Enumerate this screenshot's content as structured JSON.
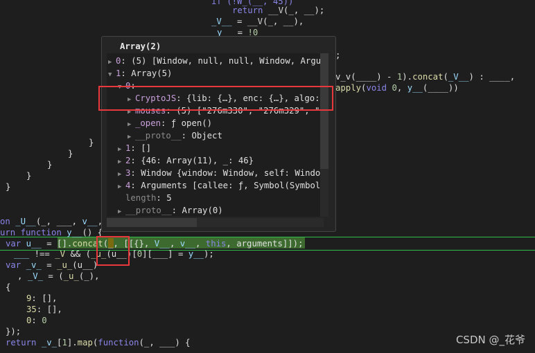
{
  "code_lines": [
    {
      "tokens": [
        [
          "if (!W_(__, 45))",
          "k"
        ]
      ]
    },
    {
      "tokens": [
        [
          "return ",
          "k"
        ],
        [
          "__V",
          "o"
        ],
        [
          "(_, __);",
          "p"
        ]
      ]
    },
    {
      "tokens": [
        [
          "_V__",
          "v"
        ],
        [
          " = ",
          "p"
        ],
        [
          "__V",
          "o"
        ],
        [
          "(_, __),",
          "p"
        ]
      ]
    },
    {
      "tokens": [
        [
          "y__",
          "v"
        ],
        [
          " = ",
          "p"
        ],
        [
          "!0",
          "n"
        ]
      ]
    },
    {
      "tokens": [
        [
          ";",
          "p"
        ]
      ]
    },
    {
      "tokens": [
        [
          "v_v(____) - ",
          "p"
        ],
        [
          "1",
          "n"
        ],
        [
          ").",
          "p"
        ],
        [
          "concat",
          "f"
        ],
        [
          "(",
          "p"
        ],
        [
          "_V__",
          "v"
        ],
        [
          ") : ____,",
          "p"
        ]
      ]
    },
    {
      "tokens": [
        [
          "apply",
          "f"
        ],
        [
          "(",
          "p"
        ],
        [
          "void ",
          "k"
        ],
        [
          "0",
          "n"
        ],
        [
          ", ",
          "p"
        ],
        [
          "y__",
          "v"
        ],
        [
          "(____))",
          "p"
        ]
      ]
    },
    {
      "tokens": [
        [
          "}",
          "p"
        ]
      ]
    },
    {
      "tokens": [
        [
          "}",
          "p"
        ]
      ]
    },
    {
      "tokens": [
        [
          "}",
          "p"
        ]
      ]
    },
    {
      "tokens": [
        [
          "}",
          "p"
        ]
      ]
    },
    {
      "tokens": [
        [
          "}",
          "p"
        ]
      ]
    },
    {
      "tokens": [
        [
          "on ",
          "k"
        ],
        [
          "_U__",
          "v"
        ],
        [
          "(_, ___, ",
          "p"
        ],
        [
          "v__",
          "v"
        ],
        [
          ",",
          "p"
        ]
      ]
    },
    {
      "tokens": [
        [
          "urn ",
          "k"
        ],
        [
          "function ",
          "k"
        ],
        [
          "y__",
          "v"
        ],
        [
          "() {",
          "p"
        ]
      ]
    },
    {
      "tokens": [
        [
          "var ",
          "k"
        ],
        [
          "u__",
          "v"
        ],
        [
          " = [].",
          "p"
        ],
        [
          "concat",
          "f"
        ],
        [
          "(_, [[{}, ",
          "p"
        ],
        [
          "V__",
          "v"
        ],
        [
          ", ",
          "p"
        ],
        [
          "v__",
          "v"
        ],
        [
          ", ",
          "p"
        ],
        [
          "this",
          "k"
        ],
        [
          ", arguments]]);",
          "p"
        ]
      ]
    },
    {
      "tokens": [
        [
          "___",
          "v"
        ],
        [
          " !== ",
          "p"
        ],
        [
          "_V",
          "f"
        ],
        [
          " && (",
          "p"
        ],
        [
          "_u_",
          "f"
        ],
        [
          "(u__)[",
          "p"
        ],
        [
          "0",
          "n"
        ],
        [
          "][___] = ",
          "p"
        ],
        [
          "y__",
          "v"
        ],
        [
          ");",
          "p"
        ]
      ]
    },
    {
      "tokens": [
        [
          "var ",
          "k"
        ],
        [
          "_v_",
          "v"
        ],
        [
          " = ",
          "p"
        ],
        [
          "_u_",
          "f"
        ],
        [
          "(u__)",
          "p"
        ]
      ]
    },
    {
      "tokens": [
        [
          ", ",
          "p"
        ],
        [
          "_V_",
          "v"
        ],
        [
          " = (",
          "p"
        ],
        [
          "_u_",
          "f"
        ],
        [
          "(_),",
          "p"
        ]
      ]
    },
    {
      "tokens": [
        [
          "{",
          "p"
        ]
      ]
    },
    {
      "tokens": [
        [
          "9",
          "f"
        ],
        [
          ": [],",
          "p"
        ]
      ]
    },
    {
      "tokens": [
        [
          "35",
          "f"
        ],
        [
          ": [],",
          "p"
        ]
      ]
    },
    {
      "tokens": [
        [
          "0",
          "f"
        ],
        [
          ": ",
          "p"
        ],
        [
          "0",
          "n"
        ]
      ]
    },
    {
      "tokens": [
        [
          "});",
          "p"
        ]
      ]
    },
    {
      "tokens": [
        [
          "return ",
          "k"
        ],
        [
          "_v_",
          "v"
        ],
        [
          "[",
          "p"
        ],
        [
          "1",
          "n"
        ],
        [
          "].",
          "p"
        ],
        [
          "map",
          "f"
        ],
        [
          "(",
          "p"
        ],
        [
          "function",
          "k"
        ],
        [
          "(_, ___) {",
          "p"
        ]
      ]
    }
  ],
  "popup": {
    "title": "Array(2)",
    "rows": [
      {
        "expanded": false,
        "key": "0",
        "text": ": (5) [Window, null, null, Window, Argu"
      },
      {
        "expanded": true,
        "key": "1",
        "text": ": Array(5)"
      },
      {
        "expanded": true,
        "key": "0",
        "text": ":"
      },
      {
        "expanded": false,
        "key": "CryptoJS",
        "text": ": {lib: {…}, enc: {…}, algo:"
      },
      {
        "expanded": false,
        "key": "mouses",
        "text": ": (5) [\"276m330\", \"276m329\", \""
      },
      {
        "expanded": false,
        "key": "_open",
        "text": ": ƒ open()"
      },
      {
        "expanded": false,
        "key": "__proto__",
        "text": ": Object"
      },
      {
        "expanded": false,
        "key": "1",
        "text": ": []"
      },
      {
        "expanded": false,
        "key": "2",
        "text": ": {46: Array(11), _: 46}"
      },
      {
        "expanded": false,
        "key": "3",
        "text": ": Window {window: Window, self: Windo"
      },
      {
        "expanded": false,
        "key": "4",
        "text": ": Arguments [callee: ƒ, Symbol(Symbol"
      },
      {
        "expanded": null,
        "key": "length",
        "text": ": 5"
      },
      {
        "expanded": false,
        "key": "__proto__",
        "text": ": Array(0)"
      }
    ]
  },
  "watermark": "CSDN @_花爷",
  "colors": {
    "highlight_border": "#2fbf4a",
    "annotation_red": "#e8383b"
  }
}
